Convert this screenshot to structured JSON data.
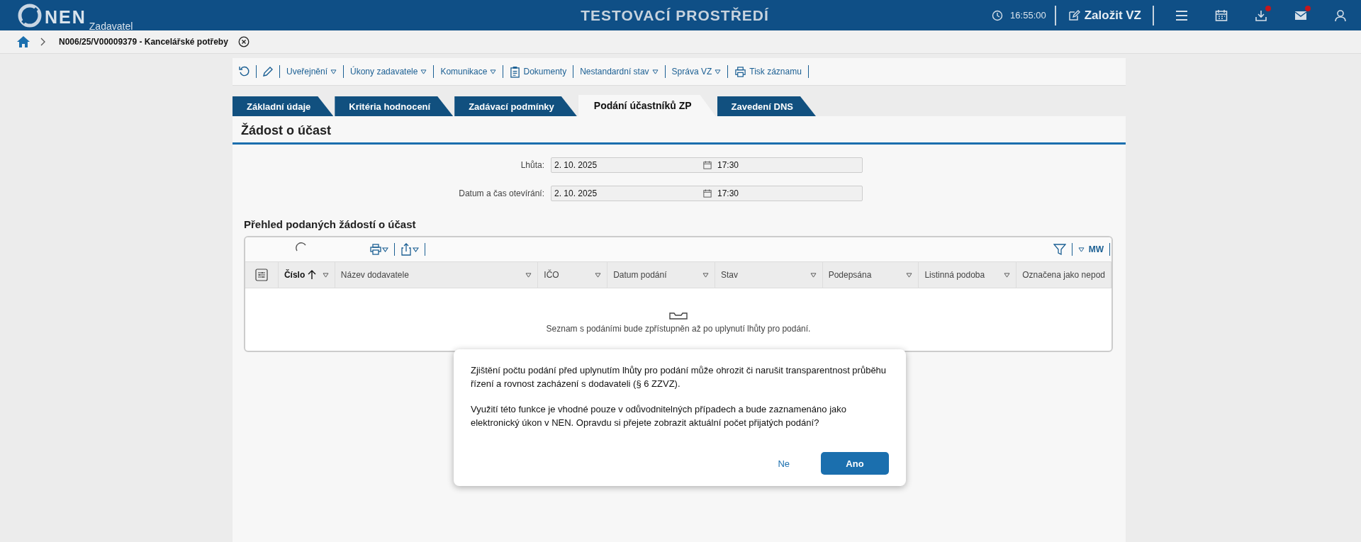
{
  "header": {
    "logo": "NEN",
    "subtitle": "Zadavatel",
    "environment": "TESTOVACÍ PROSTŘEDÍ",
    "time": "16:55:00",
    "create_button": "Založit VZ",
    "icons": [
      {
        "kind": "menu",
        "notification": false
      },
      {
        "kind": "calendar",
        "notification": false
      },
      {
        "kind": "download",
        "notification": true
      },
      {
        "kind": "mail",
        "notification": true
      },
      {
        "kind": "user",
        "notification": false
      }
    ]
  },
  "breadcrumb": {
    "current": "N006/25/V00009379 - Kancelářské potřeby"
  },
  "toolbar": [
    {
      "kind": "menu",
      "label": "Uveřejnění"
    },
    {
      "kind": "menu",
      "label": "Úkony zadavatele"
    },
    {
      "kind": "menu",
      "label": "Komunikace"
    },
    {
      "kind": "document",
      "label": "Dokumenty"
    },
    {
      "kind": "menu",
      "label": "Nestandardní stav"
    },
    {
      "kind": "menu",
      "label": "Správa VZ"
    },
    {
      "kind": "print",
      "label": "Tisk záznamu"
    }
  ],
  "tabs": [
    {
      "label": "Základní údaje",
      "selected": false
    },
    {
      "label": "Kritéria hodnocení",
      "selected": false
    },
    {
      "label": "Zadávací podmínky",
      "selected": false
    },
    {
      "label": "Podání účastníků ZP",
      "selected": true
    },
    {
      "label": "Zavedení DNS",
      "selected": false
    }
  ],
  "section_title": "Žádost o účast",
  "fields": [
    {
      "label": "Lhůta:",
      "date": "2. 10. 2025",
      "time": "17:30"
    },
    {
      "label": "Datum a čas otevírání:",
      "date": "2. 10. 2025",
      "time": "17:30"
    }
  ],
  "table": {
    "title": "Přehled podaných žádostí o účast",
    "view_label": "MW",
    "columns": [
      {
        "label": "Číslo",
        "sorted": true
      },
      {
        "label": "Název dodavatele",
        "sorted": false
      },
      {
        "label": "IČO",
        "sorted": false
      },
      {
        "label": "Datum podání",
        "sorted": false
      },
      {
        "label": "Stav",
        "sorted": false
      },
      {
        "label": "Podepsána",
        "sorted": false
      },
      {
        "label": "Listinná podoba",
        "sorted": false
      },
      {
        "label": "Označena jako nepod",
        "sorted": false
      }
    ],
    "empty_message": "Seznam s podáními bude zpřístupněn až po uplynutí lhůty pro podání."
  },
  "dialog": {
    "paragraphs": [
      "Zjištění počtu podání před uplynutím lhůty pro podání může ohrozit či narušit transparentnost průběhu řízení a rovnost zacházení s dodavateli (§ 6 ZZVZ).",
      "Využití této funkce je vhodné pouze v odůvodnitelných případech a bude zaznamenáno jako elektronický úkon v NEN. Opravdu si přejete zobrazit aktuální počet přijatých podání?"
    ],
    "buttons": [
      {
        "label": "Ne",
        "kind": "secondary"
      },
      {
        "label": "Ano",
        "kind": "primary"
      }
    ]
  }
}
